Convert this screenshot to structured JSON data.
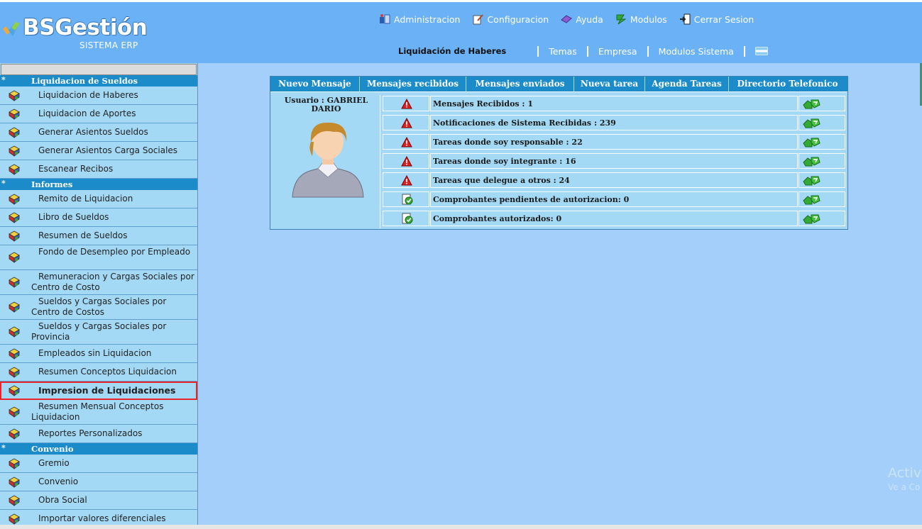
{
  "logo": {
    "title": "BSGestión",
    "subtitle": "SISTEMA ERP"
  },
  "topnav": [
    {
      "label": "Administracion",
      "icon": "admin-icon"
    },
    {
      "label": "Configuracion",
      "icon": "config-icon"
    },
    {
      "label": "Ayuda",
      "icon": "help-icon"
    },
    {
      "label": "Modulos",
      "icon": "modules-icon"
    },
    {
      "label": "Cerrar Sesion",
      "icon": "logout-icon"
    }
  ],
  "subnav": {
    "current": "Liquidación de Haberes",
    "links": [
      "Temas",
      "Empresa",
      "Modulos Sistema"
    ]
  },
  "sidebar": {
    "sections": [
      {
        "title": "Liquidacion de Sueldos",
        "items": [
          {
            "label": "Liquidacion de Haberes"
          },
          {
            "label": "Liquidacion de Aportes"
          },
          {
            "label": "Generar Asientos Sueldos"
          },
          {
            "label": "Generar Asientos Carga Sociales"
          },
          {
            "label": "Escanear Recibos"
          }
        ]
      },
      {
        "title": "Informes",
        "items": [
          {
            "label": "Remito de Liquidacion"
          },
          {
            "label": "Libro de Sueldos"
          },
          {
            "label": "Resumen de Sueldos"
          },
          {
            "label": "Fondo de Desempleo por Empleado"
          },
          {
            "label": "Remuneracion y Cargas Sociales por Centro de Costo"
          },
          {
            "label": "Sueldos y Cargas Sociales por Centro de Costos"
          },
          {
            "label": "Sueldos y Cargas Sociales por Provincia"
          },
          {
            "label": "Empleados sin Liquidacion"
          },
          {
            "label": "Resumen Conceptos Liquidacion"
          },
          {
            "label": "Impresion de Liquidaciones"
          },
          {
            "label": "Resumen Mensual Conceptos Liquidacion"
          },
          {
            "label": "Reportes Personalizados"
          }
        ]
      },
      {
        "title": "Convenio",
        "items": [
          {
            "label": "Gremio"
          },
          {
            "label": "Convenio"
          },
          {
            "label": "Obra Social"
          },
          {
            "label": "Importar valores diferenciales"
          }
        ]
      }
    ],
    "star": "*"
  },
  "panel": {
    "tabs": [
      "Nuevo Mensaje",
      "Mensajes recibidos",
      "Mensajes enviados",
      "Nueva tarea",
      "Agenda Tareas",
      "Directorio Telefonico"
    ],
    "user_label": "Usuario : GABRIEL DARIO",
    "rows": [
      {
        "text": "Mensajes Recibidos : 1",
        "status": "warning"
      },
      {
        "text": "Notificaciones de Sistema Recibidas : 239",
        "status": "warning"
      },
      {
        "text": "Tareas donde soy responsable : 22",
        "status": "warning"
      },
      {
        "text": "Tareas donde soy integrante : 16",
        "status": "warning"
      },
      {
        "text": "Tareas que delegue a otros : 24",
        "status": "warning"
      },
      {
        "text": "Comprobantes pendientes de autorizacion: 0",
        "status": "ok"
      },
      {
        "text": "Comprobantes autorizados: 0",
        "status": "ok"
      }
    ]
  },
  "watermark": {
    "line1": "Activ",
    "line2": "Ve a Co"
  },
  "colors": {
    "header": "#6ab2f5",
    "background": "#a3cffa",
    "section": "#1b8cc9",
    "highlight": "#e8252c"
  }
}
